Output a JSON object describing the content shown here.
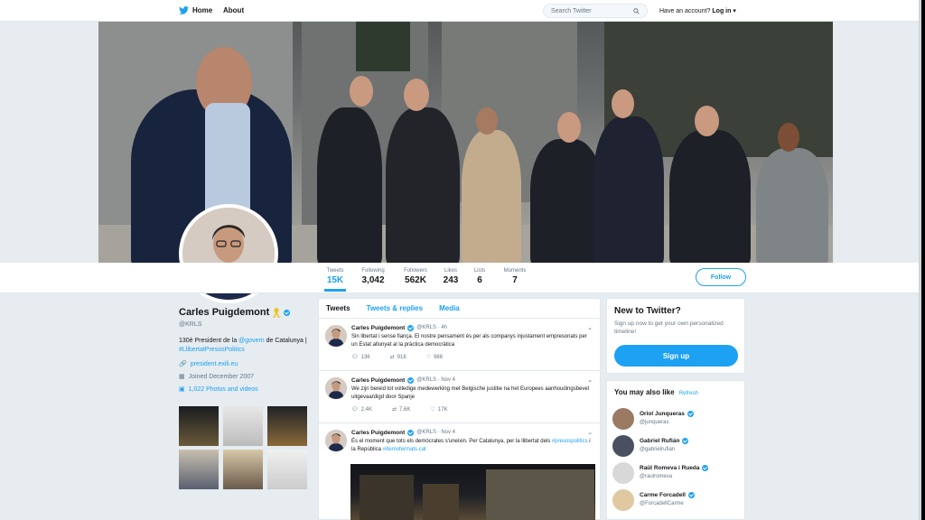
{
  "nav": {
    "home_label": "Home",
    "about_label": "About",
    "search_placeholder": "Search Twitter",
    "account_prompt": "Have an account?",
    "login_label": "Log in"
  },
  "stats": [
    {
      "label": "Tweets",
      "value": "15K"
    },
    {
      "label": "Following",
      "value": "3,042"
    },
    {
      "label": "Followers",
      "value": "562K"
    },
    {
      "label": "Likes",
      "value": "243"
    },
    {
      "label": "Lists",
      "value": "6"
    },
    {
      "label": "Moments",
      "value": "7"
    }
  ],
  "follow_label": "Follow",
  "profile": {
    "name": "Carles Puigdemont",
    "handle": "@KRLS",
    "bio_prefix": "130è President de la ",
    "bio_link1": "@govern",
    "bio_mid": " de Catalunya | ",
    "bio_link2": "#LlibertatPresosPolitics",
    "website": "president.exili.eu",
    "joined": "Joined December 2007",
    "photos": "1,022 Photos and videos"
  },
  "timeline": {
    "tabs": [
      "Tweets",
      "Tweets & replies",
      "Media"
    ],
    "tweets": [
      {
        "name": "Carles Puigdemont",
        "meta": "@KRLS · 4h",
        "text": "Sin libertat i sense fiança. El nostre pensament és per als companys injustament empresonats per un Estat allunyat al la pràctica democràtica",
        "replies": "136",
        "retweets": "918",
        "likes": "986"
      },
      {
        "name": "Carles Puigdemont",
        "meta": "@KRLS · Nov 4",
        "text": "We zijn bereid tot volledige medewerking met Belgische justitie na het Europees aanhoudingsbevel uitgevaardigd door Spanje",
        "replies": "2.4K",
        "retweets": "7.6K",
        "likes": "17K"
      },
      {
        "name": "Carles Puigdemont",
        "meta": "@KRLS · Nov 4",
        "text_prefix": "És el moment que tots els demòcrates s'uneixin. Per Catalunya, per la llibertat dels ",
        "text_link1": "#presospolitics",
        "text_mid": " i la República ",
        "text_link2": "#demofermats.cat"
      }
    ]
  },
  "signup_box": {
    "title": "New to Twitter?",
    "text": "Sign up now to get your own personalized timeline!",
    "button": "Sign up"
  },
  "suggestions": {
    "title": "You may also like",
    "refresh": "Refresh",
    "people": [
      {
        "name": "Oriol Junqueras",
        "handle": "@junqueras"
      },
      {
        "name": "Gabriel Rufián",
        "handle": "@gabrielrufian"
      },
      {
        "name": "Raül Romeva i Rueda",
        "handle": "@raulromeva"
      },
      {
        "name": "Carme Forcadell",
        "handle": "@ForcadellCarme"
      }
    ]
  },
  "colors": {
    "accent": "#1da1f2",
    "text": "#14171a",
    "muted": "#657786"
  }
}
